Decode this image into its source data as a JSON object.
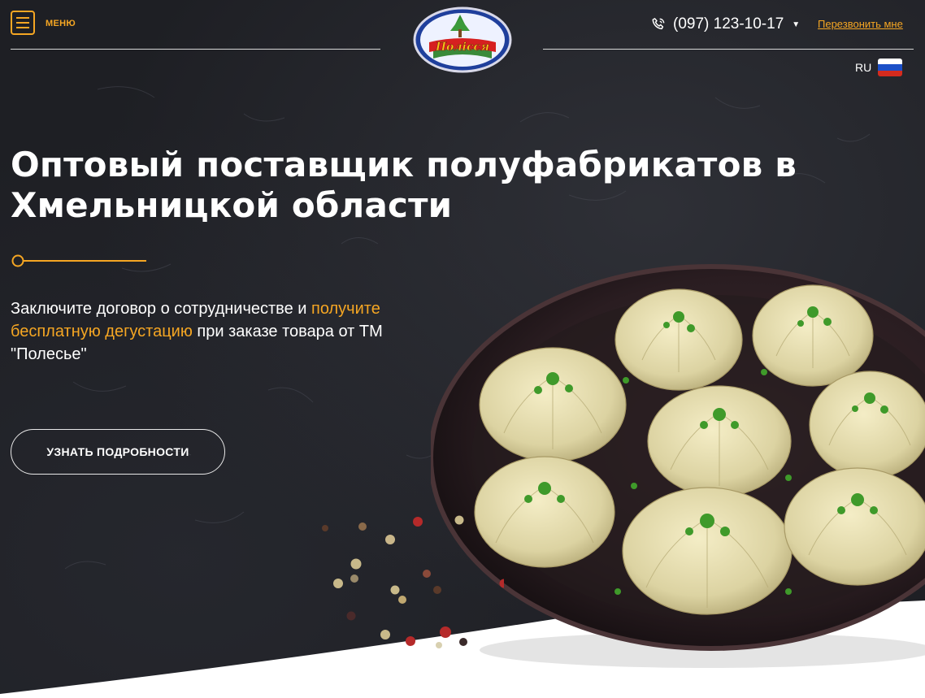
{
  "header": {
    "menu_label": "МЕНЮ",
    "logo_text": "Полісся",
    "phone": "(097) 123-10-17",
    "callback_label": "Перезвонить мне",
    "lang": "RU"
  },
  "hero": {
    "title": "Оптовый поставщик полуфабрикатов в Хмельницкой области",
    "text_before": "Заключите договор о сотрудничестве и ",
    "text_highlight": "получите бесплатную дегустацию",
    "text_after": " при заказе товара от ТМ \"Полесье\"",
    "cta_label": "УЗНАТЬ ПОДРОБНОСТИ"
  },
  "colors": {
    "accent": "#f5a623",
    "background": "#1e1f24",
    "text": "#ffffff"
  },
  "icons": [
    "menu-icon",
    "phone-icon",
    "caret-down-icon",
    "flag-ru-icon"
  ]
}
